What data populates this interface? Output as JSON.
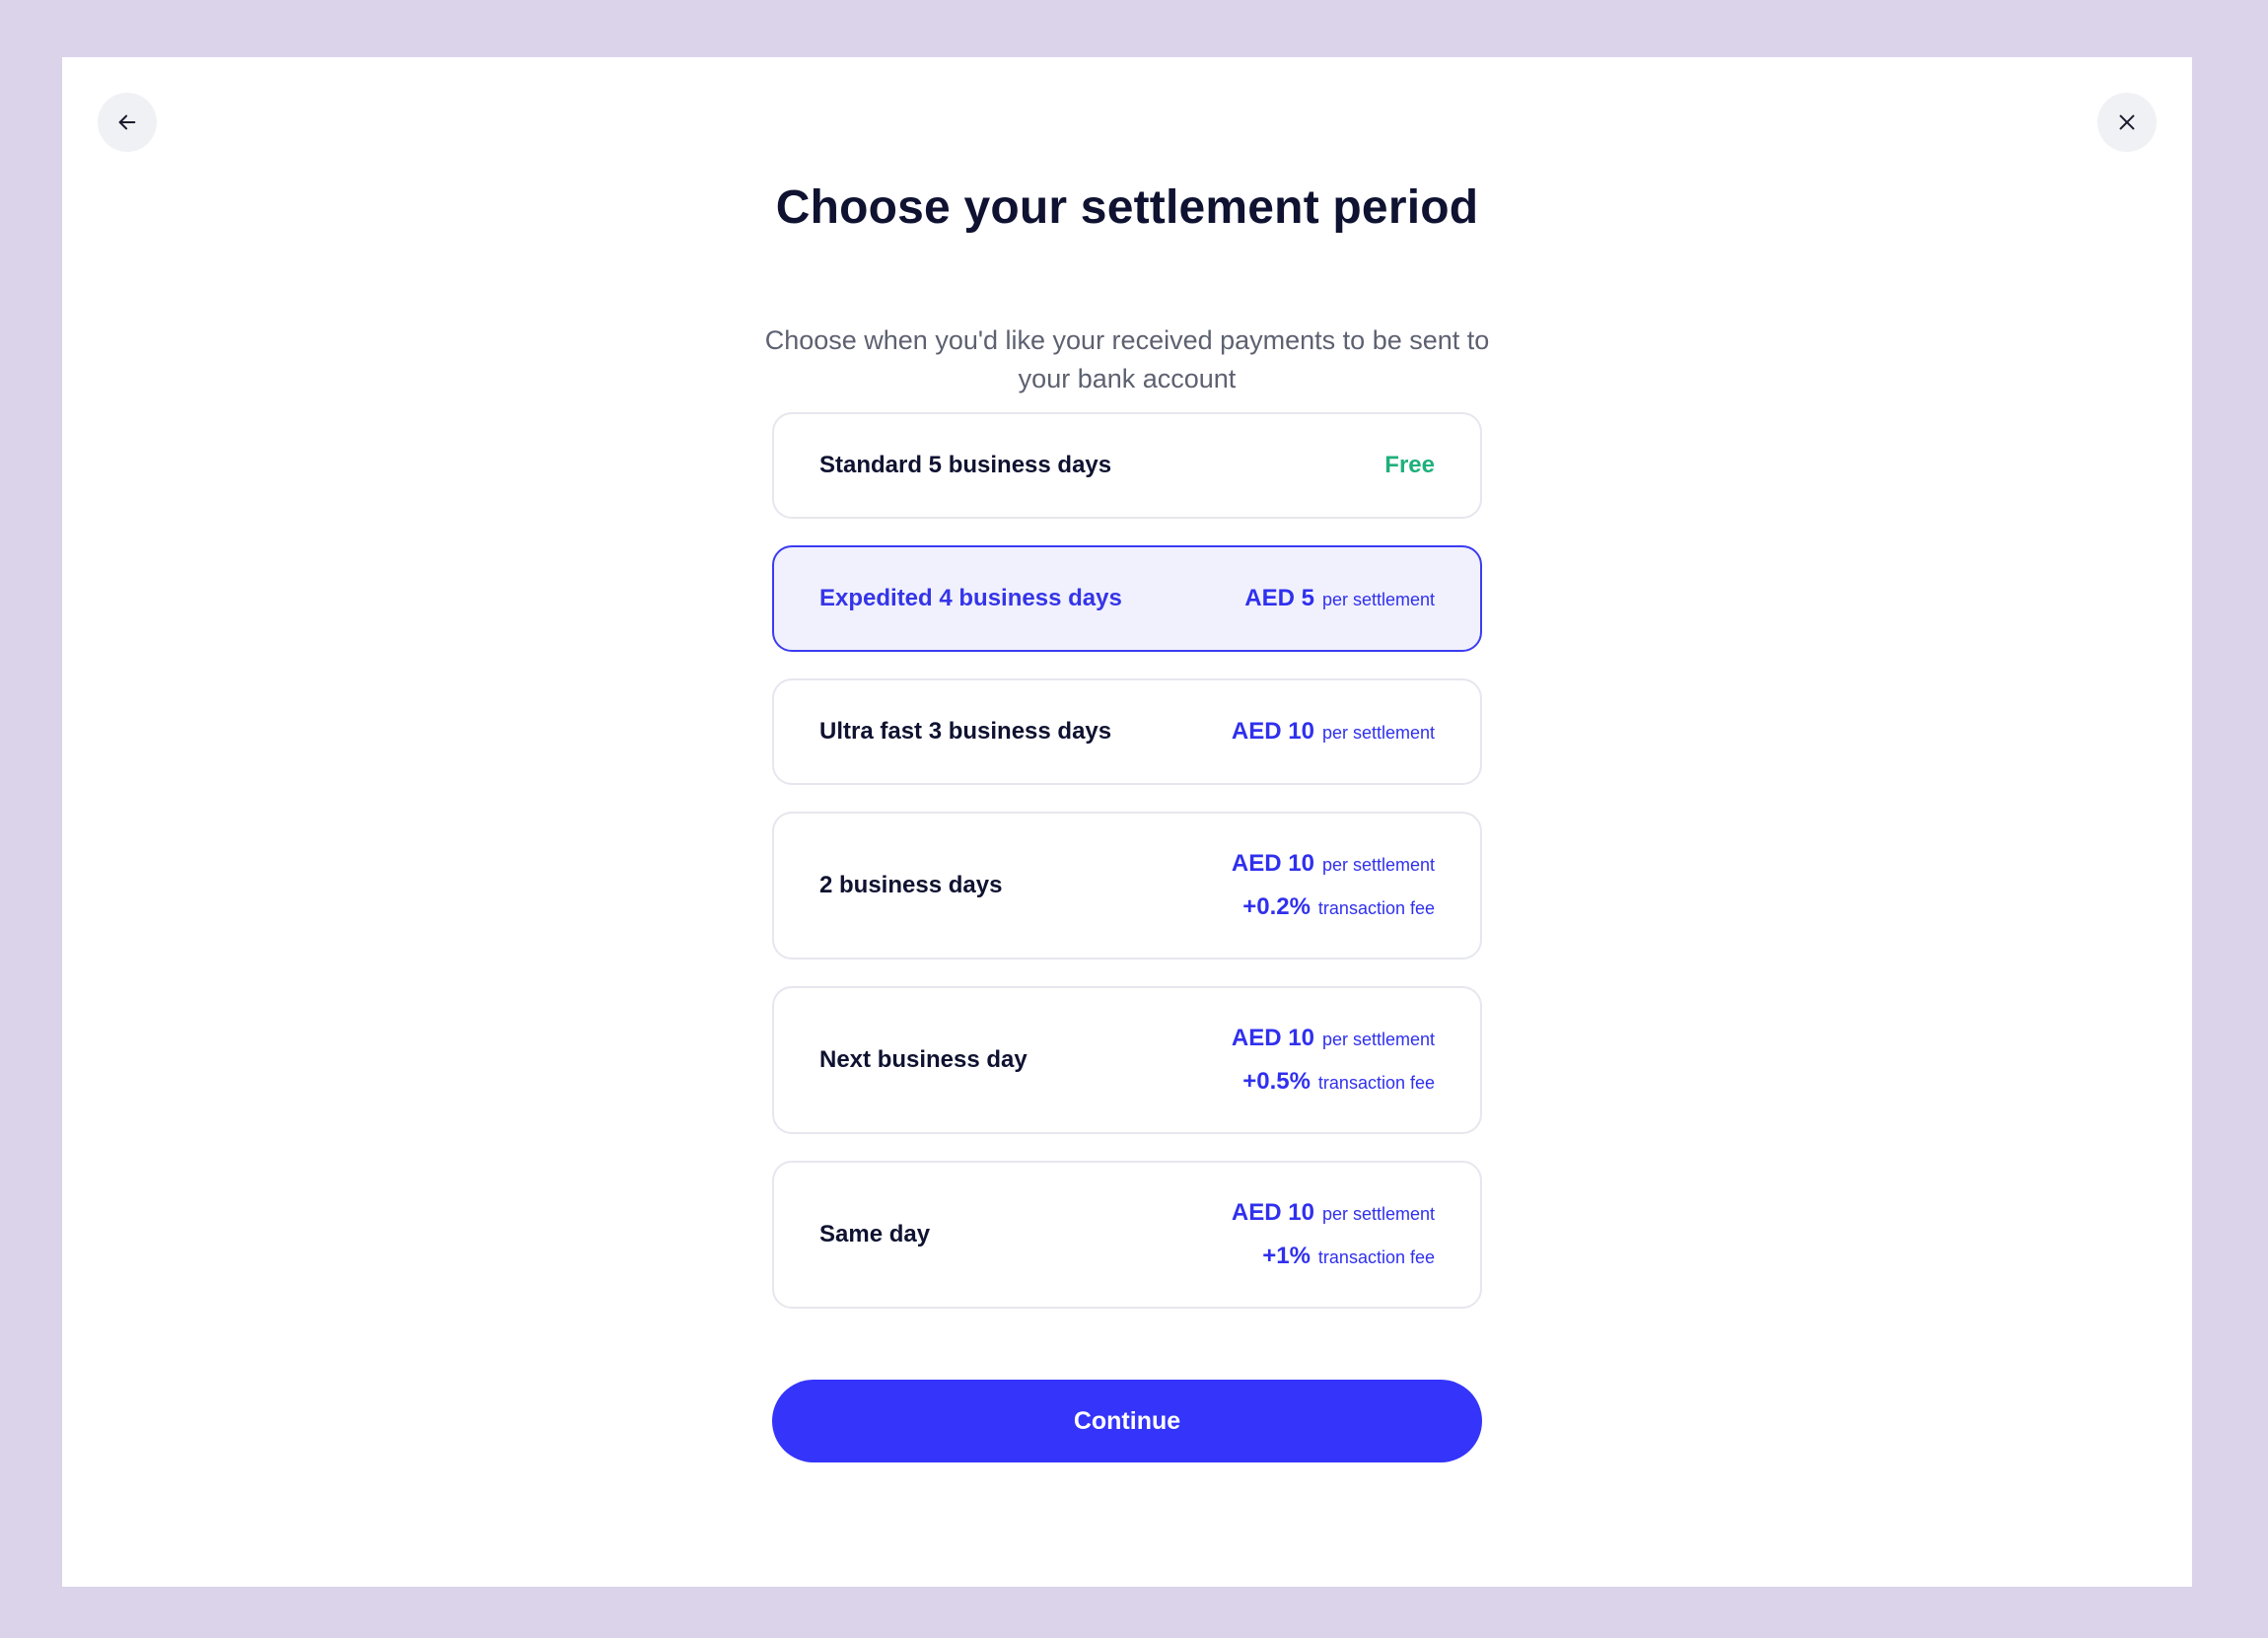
{
  "title": "Choose your settlement period",
  "subtitle": "Choose when you'd like your received payments to be sent to your bank account",
  "colors": {
    "background": "#dbd3ea",
    "accent": "#3434fb",
    "free": "#1fb07b",
    "selected_bg": "#f1f1fd"
  },
  "nav": {
    "back_icon": "arrow-left-icon",
    "close_icon": "close-icon"
  },
  "options": [
    {
      "name": "Standard 5 business days",
      "free": "Free"
    },
    {
      "name": "Expedited 4 business days",
      "amount": "AED 5",
      "unit": "per settlement",
      "selected": true
    },
    {
      "name": "Ultra fast 3 business days",
      "amount": "AED 10",
      "unit": "per settlement"
    },
    {
      "name": "2 business days",
      "amount": "AED 10",
      "unit": "per settlement",
      "fee": "+0.2%",
      "fee_unit": "transaction fee"
    },
    {
      "name": "Next business day",
      "amount": "AED 10",
      "unit": "per settlement",
      "fee": "+0.5%",
      "fee_unit": "transaction fee"
    },
    {
      "name": "Same day",
      "amount": "AED 10",
      "unit": "per settlement",
      "fee": "+1%",
      "fee_unit": "transaction fee"
    }
  ],
  "continue_label": "Continue"
}
